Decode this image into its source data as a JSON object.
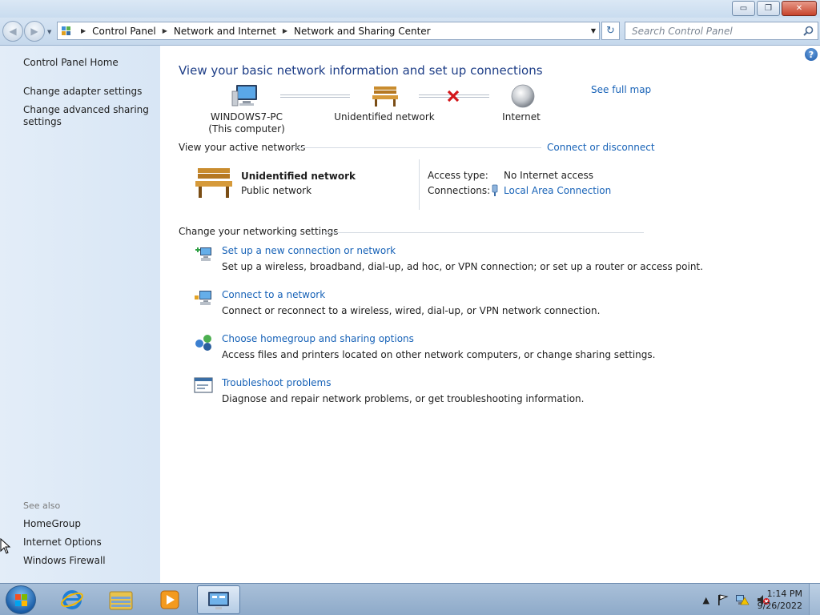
{
  "window": {
    "controls": {
      "minimize": "▭",
      "maximize": "❐",
      "close": "✕"
    }
  },
  "nav": {
    "back_glyph": "◀",
    "forward_glyph": "▶",
    "dropdown_glyph": "▼",
    "breadcrumb": [
      "Control Panel",
      "Network and Internet",
      "Network and Sharing Center"
    ],
    "refresh_glyph": "↻",
    "search_placeholder": "Search Control Panel"
  },
  "sidebar": {
    "home": "Control Panel Home",
    "links": [
      "Change adapter settings",
      "Change advanced sharing settings"
    ],
    "see_also_label": "See also",
    "see_also": [
      "HomeGroup",
      "Internet Options",
      "Windows Firewall"
    ]
  },
  "main": {
    "help_glyph": "?",
    "title": "View your basic network information and set up connections",
    "see_full_map": "See full map",
    "map": {
      "computer_name": "WINDOWS7-PC",
      "computer_sub": "(This computer)",
      "network": "Unidentified network",
      "internet": "Internet"
    },
    "active_networks": {
      "heading": "View your active networks",
      "connect_link": "Connect or disconnect",
      "network_name": "Unidentified network",
      "network_type": "Public network",
      "access_type_label": "Access type:",
      "access_type_value": "No Internet access",
      "connections_label": "Connections:",
      "connections_value": "Local Area Connection"
    },
    "settings": {
      "heading": "Change your networking settings",
      "tasks": [
        {
          "title": "Set up a new connection or network",
          "desc": "Set up a wireless, broadband, dial-up, ad hoc, or VPN connection; or set up a router or access point."
        },
        {
          "title": "Connect to a network",
          "desc": "Connect or reconnect to a wireless, wired, dial-up, or VPN network connection."
        },
        {
          "title": "Choose homegroup and sharing options",
          "desc": "Access files and printers located on other network computers, or change sharing settings."
        },
        {
          "title": "Troubleshoot problems",
          "desc": "Diagnose and repair network problems, or get troubleshooting information."
        }
      ]
    }
  },
  "taskbar": {
    "tray_arrow": "▲",
    "time": "1:14 PM",
    "date": "9/26/2022"
  }
}
